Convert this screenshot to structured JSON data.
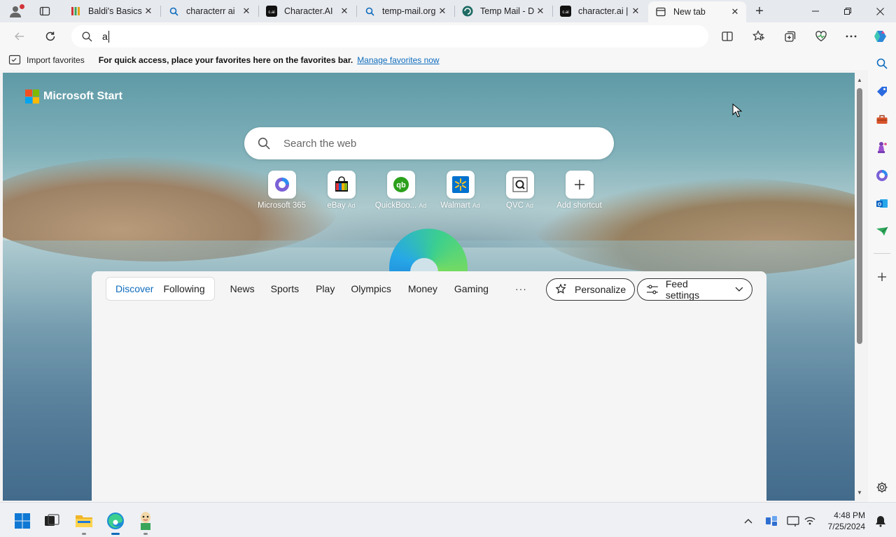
{
  "tabs": [
    {
      "title": "Baldi's Basics",
      "icon": "baldi-icon"
    },
    {
      "title": "characterr ai",
      "icon": "search-icon"
    },
    {
      "title": "Character.AI",
      "icon": "characterai-icon"
    },
    {
      "title": "temp-mail.org",
      "icon": "search-icon"
    },
    {
      "title": "Temp Mail - D",
      "icon": "tempmail-icon"
    },
    {
      "title": "character.ai | f",
      "icon": "characterai-icon"
    },
    {
      "title": "New tab",
      "icon": "newtab-icon",
      "active": true
    }
  ],
  "address_bar": {
    "value": "a"
  },
  "favorites_bar": {
    "import_label": "Import favorites",
    "message": "For quick access, place your favorites here on the favorites bar.",
    "link": "Manage favorites now"
  },
  "newtab": {
    "brand": "Microsoft Start",
    "search_placeholder": "Search the web",
    "shortcuts": [
      {
        "label": "Microsoft 365",
        "ad": ""
      },
      {
        "label": "eBay",
        "ad": "Ad"
      },
      {
        "label": "QuickBoo...",
        "ad": "Ad"
      },
      {
        "label": "Walmart",
        "ad": "Ad"
      },
      {
        "label": "QVC",
        "ad": "Ad"
      },
      {
        "label": "Add shortcut",
        "ad": ""
      }
    ]
  },
  "feed": {
    "segment": [
      {
        "label": "Discover",
        "selected": true
      },
      {
        "label": "Following"
      }
    ],
    "nav": [
      "News",
      "Sports",
      "Play",
      "Olympics",
      "Money",
      "Gaming"
    ],
    "more": "···",
    "personalize": "Personalize",
    "feed_settings": "Feed settings"
  },
  "clock": {
    "time": "4:48 PM",
    "date": "7/25/2024"
  },
  "colors": {
    "accent": "#0f6cbd",
    "tab_strip": "#e6e9ee",
    "toolbar": "#f7f7f7"
  }
}
